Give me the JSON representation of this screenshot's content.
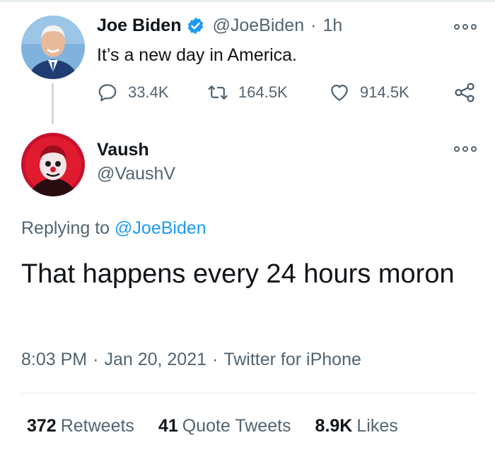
{
  "parent_tweet": {
    "name": "Joe Biden",
    "handle": "@JoeBiden",
    "separator": "·",
    "time": "1h",
    "text": "It’s a new day in America.",
    "replies": "33.4K",
    "retweets": "164.5K",
    "likes": "914.5K",
    "verified_color": "#1d9bf0"
  },
  "reply_tweet": {
    "name": "Vaush",
    "handle": "@VaushV",
    "replying_prefix": "Replying to",
    "replying_handle": "@JoeBiden",
    "text": "That happens every 24 hours moron",
    "time": "8:03 PM",
    "date": "Jan 20, 2021",
    "source": "Twitter for iPhone",
    "separator": "·",
    "retweets_count": "372",
    "retweets_label": "Retweets",
    "quote_count": "41",
    "quote_label": "Quote Tweets",
    "likes_count": "8.9K",
    "likes_label": "Likes"
  },
  "icons": {
    "reply": "reply-icon",
    "retweet": "retweet-icon",
    "like": "heart-icon",
    "share": "share-icon",
    "more": "more-icon",
    "verified": "verified-badge-icon"
  },
  "colors": {
    "text_primary": "#0f1419",
    "text_secondary": "#536471",
    "link": "#1d9bf0",
    "divider": "#e6ecf0"
  }
}
